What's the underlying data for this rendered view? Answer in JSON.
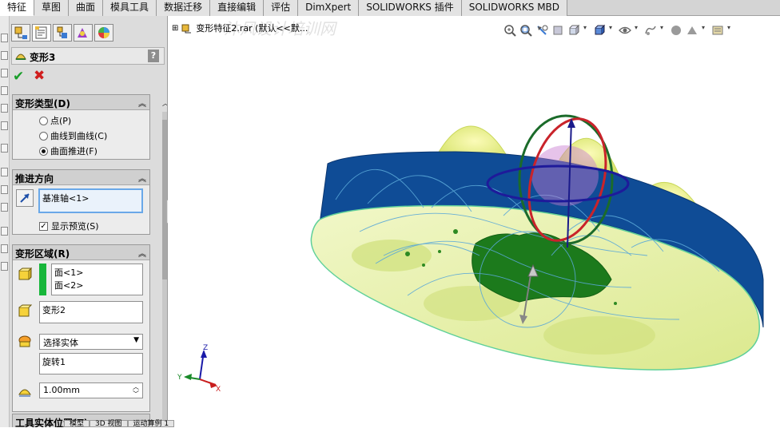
{
  "top_tabs": [
    "特征",
    "草图",
    "曲面",
    "模具工具",
    "数据迁移",
    "直接编辑",
    "评估",
    "DimXpert",
    "SOLIDWORKS 插件",
    "SOLIDWORKS MBD"
  ],
  "property_manager": {
    "title": "变形3",
    "help": "?",
    "deform_type": {
      "header": "变形类型(D)",
      "options": [
        "点(P)",
        "曲线到曲线(C)",
        "曲面推进(F)"
      ],
      "selected": "曲面推进(F)"
    },
    "push_direction": {
      "header": "推进方向",
      "value": "基准轴<1>",
      "show_preview_label": "显示预览(S)",
      "show_preview_checked": true
    },
    "deform_region": {
      "header": "变形区域(R)",
      "faces": [
        "面<1>",
        "面<2>"
      ],
      "body_value": "变形2",
      "combo_value": "选择实体",
      "tool_value": "旋转1",
      "distance": "1.00mm"
    },
    "next_group_header": "工具实体位置(T)"
  },
  "bottom_tabs": [
    "模型",
    "3D 视图",
    "运动算例 1"
  ],
  "feature_tree": {
    "label": "变形特征2.rar (默认<<默..."
  },
  "view_toolbar_icons": [
    "zoom-to-fit-icon",
    "zoom-area-icon",
    "previous-view-icon",
    "section-view-icon",
    "view-orientation-icon",
    "display-style-icon",
    "hide-show-icon",
    "edit-appearance-icon",
    "scene-icon",
    "view-settings-icon"
  ],
  "triad": {
    "x": "X",
    "y": "Y",
    "z": "Z"
  },
  "watermark": "沐风设计培训网"
}
